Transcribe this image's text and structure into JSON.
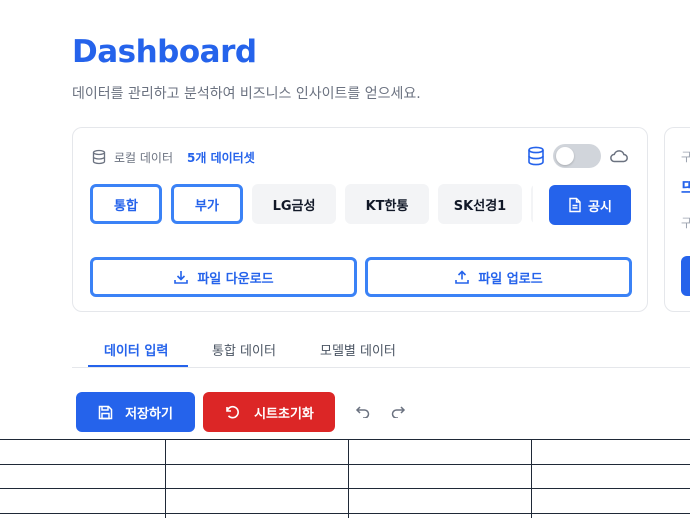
{
  "header": {
    "title": "Dashboard",
    "subtitle": "데이터를 관리하고 분석하여 비즈니스 인사이트를 얻으세요."
  },
  "source_card": {
    "local_label": "로컬 데이터",
    "dataset_count": "5개 데이터셋",
    "toggle_on": false,
    "chips": [
      {
        "label": "통합",
        "selected": true
      },
      {
        "label": "부가",
        "selected": true
      },
      {
        "label": "LG금성",
        "selected": false
      },
      {
        "label": "KT한통",
        "selected": false
      },
      {
        "label": "SK선경1",
        "selected": false
      }
    ],
    "notice_label": "공시",
    "download_label": "파일 다운로드",
    "upload_label": "파일 업로드"
  },
  "side_card": {
    "line1": "구",
    "line2": "뜨",
    "line3": "구"
  },
  "tabs": [
    {
      "label": "데이터 입력",
      "active": true
    },
    {
      "label": "통합 데이터",
      "active": false
    },
    {
      "label": "모델별 데이터",
      "active": false
    }
  ],
  "toolbar": {
    "save_label": "저장하기",
    "reset_label": "시트초기화"
  },
  "colors": {
    "primary": "#2563eb",
    "danger": "#dc2626",
    "chip_bg": "#f3f4f6"
  }
}
